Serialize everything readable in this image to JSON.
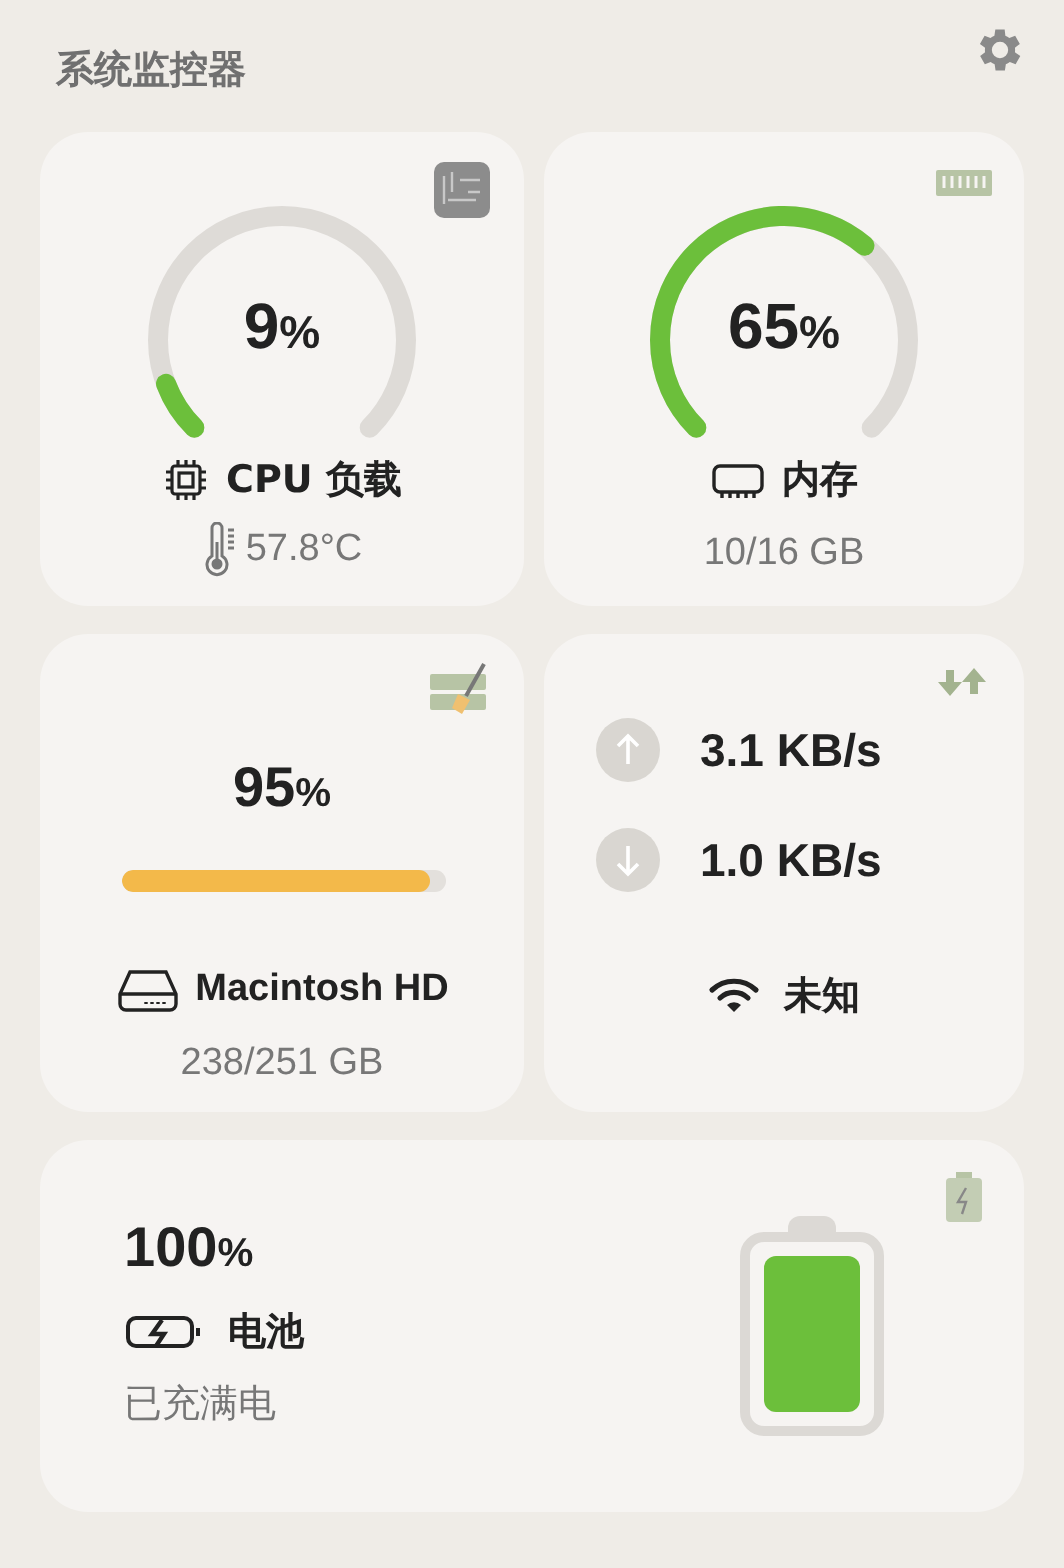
{
  "title": "系统监控器",
  "cpu": {
    "value": "9",
    "unit": "%",
    "label": "CPU 负载",
    "temperature": "57.8°C"
  },
  "memory": {
    "value": "65",
    "unit": "%",
    "label": "内存",
    "usage": "10/16 GB"
  },
  "disk": {
    "value": "95",
    "unit": "%",
    "level": 0.95,
    "name": "Macintosh HD",
    "usage": "238/251 GB"
  },
  "network": {
    "upload": "3.1 KB/s",
    "download": "1.0 KB/s",
    "connection": "未知"
  },
  "battery": {
    "value": "100",
    "unit": "%",
    "label": "电池",
    "status": "已充满电"
  }
}
